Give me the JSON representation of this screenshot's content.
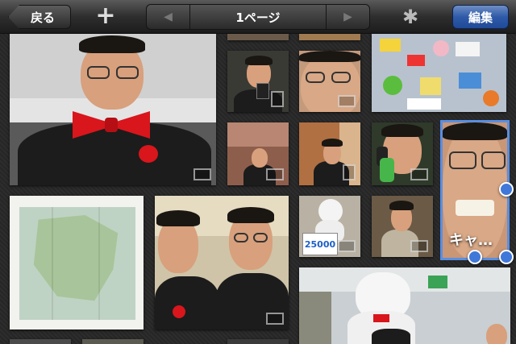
{
  "toolbar": {
    "back_label": "戻る",
    "add_label": "+",
    "page_label": "1ページ",
    "prev_arrow": "◀",
    "next_arrow": "▶",
    "gear_glyph": "✱",
    "edit_label": "編集"
  },
  "photos": {
    "selected_caption": "キャ…"
  },
  "colors": {
    "edit_accent": "#2f5aa8",
    "selection": "#5a8ee0"
  }
}
